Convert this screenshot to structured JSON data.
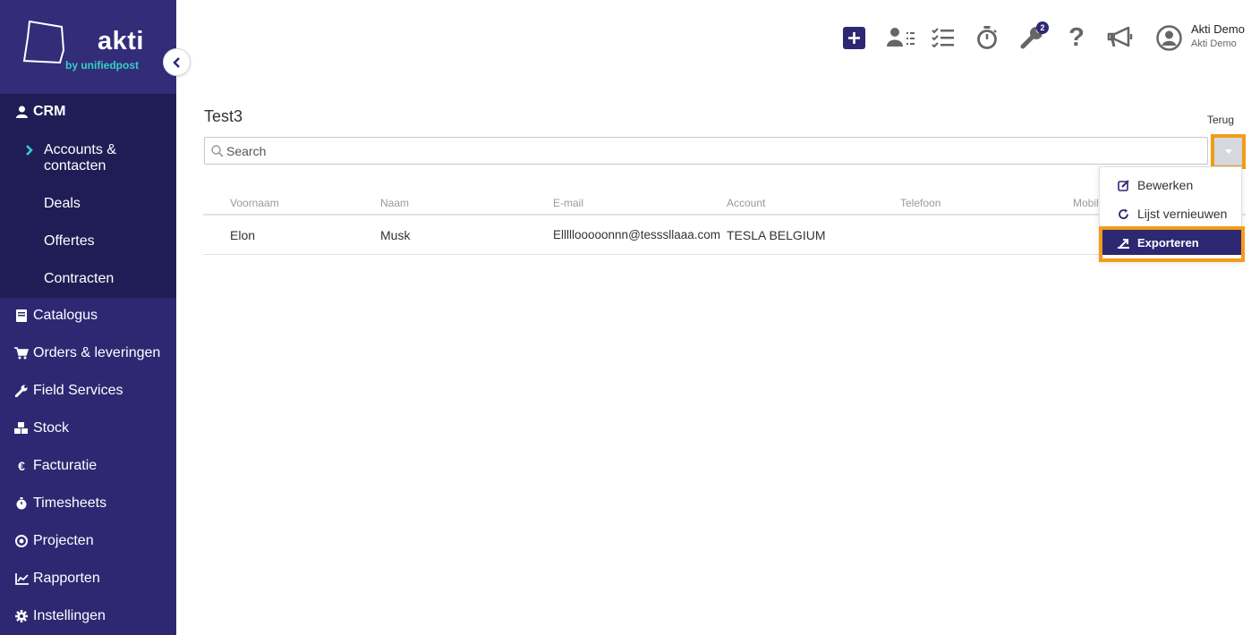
{
  "brand": {
    "name": "akti",
    "sub": "by unifiedpost",
    "accent": "#33d1c6",
    "sidebar_bg": "#2e2873",
    "highlight": "#f39c1a"
  },
  "sidebar": {
    "crm": {
      "label": "CRM",
      "icon": "user-icon"
    },
    "crm_items": [
      {
        "label": "Accounts & contacten",
        "active": true
      },
      {
        "label": "Deals"
      },
      {
        "label": "Offertes"
      },
      {
        "label": "Contracten"
      }
    ],
    "items": [
      {
        "label": "Catalogus",
        "icon": "book-icon"
      },
      {
        "label": "Orders & leveringen",
        "icon": "cart-icon"
      },
      {
        "label": "Field Services",
        "icon": "wrench-icon"
      },
      {
        "label": "Stock",
        "icon": "boxes-icon"
      },
      {
        "label": "Facturatie",
        "icon": "euro-icon"
      },
      {
        "label": "Timesheets",
        "icon": "stopwatch-icon"
      },
      {
        "label": "Projecten",
        "icon": "target-icon"
      },
      {
        "label": "Rapporten",
        "icon": "chart-line-icon"
      },
      {
        "label": "Instellingen",
        "icon": "gear-icon"
      }
    ]
  },
  "topbar": {
    "notification_count": "2",
    "user": {
      "name": "Akti Demo",
      "company": "Akti Demo"
    }
  },
  "page": {
    "title": "Test3",
    "back_label": "Terug",
    "search_placeholder": "Search"
  },
  "table": {
    "columns": [
      "Voornaam",
      "Naam",
      "E-mail",
      "Account",
      "Telefoon",
      "Mobil"
    ],
    "rows": [
      [
        "Elon",
        "Musk",
        "Elllllooooonnn@tessslla‌aa.com",
        "TESLA BELGIUM",
        "",
        ""
      ]
    ]
  },
  "menu": {
    "items": [
      {
        "label": "Bewerken",
        "icon": "edit-icon"
      },
      {
        "label": "Lijst vernieuwen",
        "icon": "refresh-icon"
      },
      {
        "label": "Exporteren",
        "icon": "export-icon",
        "active": true
      }
    ]
  }
}
